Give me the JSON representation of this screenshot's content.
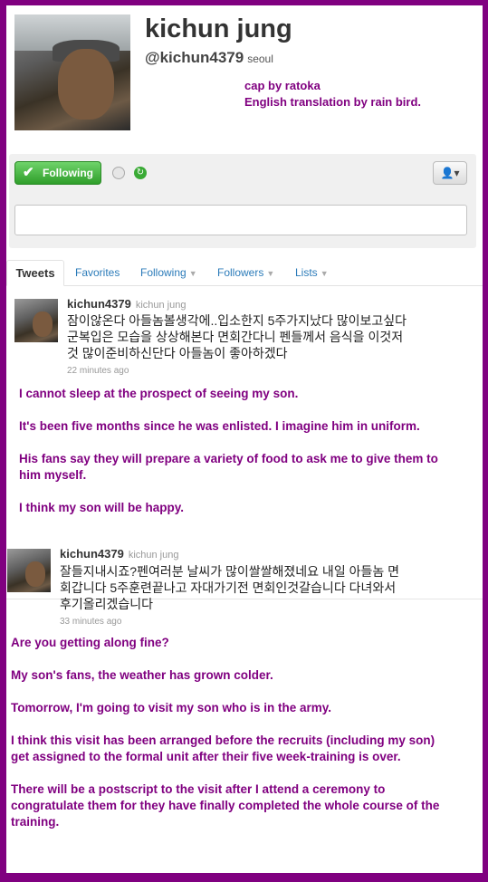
{
  "profile": {
    "name": "kichun jung",
    "handle": "@kichun4379",
    "location": "seoul"
  },
  "credits": {
    "cap": "cap by ratoka",
    "translation": "English translation by rain bird."
  },
  "actions": {
    "follow_label": "Following",
    "follow_color": "#3aaa35"
  },
  "tabs": [
    {
      "label": "Tweets"
    },
    {
      "label": "Favorites"
    },
    {
      "label": "Following"
    },
    {
      "label": "Followers"
    },
    {
      "label": "Lists"
    }
  ],
  "tweets": [
    {
      "username": "kichun4379",
      "fullname": "kichun jung",
      "text": "잠이않온다 아들놈볼생각에..입소한지 5주가지났다 많이보고싶다\n군복입은 모습을 상상해본다 면회간다니 펜들께서 음식을 이것저\n것 많이준비하신단다 아들놈이 좋아하겠다",
      "time": "22 minutes ago",
      "translation": "I cannot sleep at the prospect of seeing my son.\n\nIt's been five months since he was enlisted. I imagine him in uniform.\n\nHis fans say they will prepare a variety of food to ask me to give them to\nhim myself.\n\nI think my son will be happy."
    },
    {
      "username": "kichun4379",
      "fullname": "kichun jung",
      "text": "잘들지내시죠?펜여러분 날씨가 많이쌀쌀해졌네요 내일 아들놈 면\n회갑니다 5주훈련끝나고 자대가기전 면회인것갈습니다 다녀와서\n후기올리겠습니다",
      "time": "33 minutes ago",
      "translation": "Are you getting along fine?\n\nMy son's fans, the weather has grown colder.\n\nTomorrow, I'm going to visit my son who is in the army.\n\nI think this visit has been arranged before the recruits (including my son)\nget assigned to the formal unit after their five week-training is over.\n\nThere will be a postscript to the visit after I attend a ceremony to\ncongratulate them for they have finally completed the whole course of the\ntraining."
    }
  ],
  "colors": {
    "frame": "#800080",
    "link": "#2b7bb9",
    "translation": "#800080"
  }
}
